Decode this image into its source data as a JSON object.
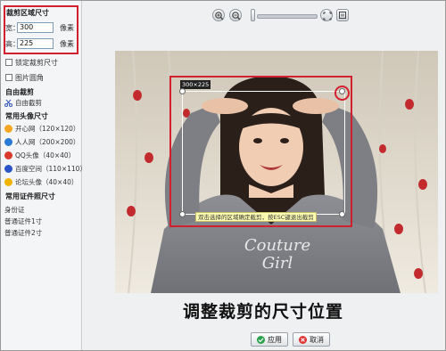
{
  "crop_size": {
    "title": "裁剪区域尺寸",
    "width_label": "宽：",
    "width_value": "300",
    "height_label": "高：",
    "height_value": "225",
    "unit": "像素"
  },
  "options": {
    "lock_size": "锁定裁剪尺寸",
    "round_corner": "图片圆角"
  },
  "free_crop": {
    "title": "自由裁剪",
    "item": "自由截剪"
  },
  "avatar_sizes": {
    "title": "常用头像尺寸",
    "items": [
      {
        "label": "开心网（120×120）",
        "color": "#f5a623"
      },
      {
        "label": "人人网（200×200）",
        "color": "#2a7bd6"
      },
      {
        "label": "QQ头像（40×40）",
        "color": "#d93a2b"
      },
      {
        "label": "百度空间（110×110）",
        "color": "#2a55c8"
      },
      {
        "label": "论坛头像（40×40）",
        "color": "#f0b400"
      }
    ]
  },
  "id_sizes": {
    "title": "常用证件照尺寸",
    "items": [
      "身份证",
      "普通证件1寸",
      "普通证件2寸"
    ]
  },
  "toolbar": {
    "icons": [
      "zoom-in-icon",
      "zoom-out-icon",
      "fit-icon",
      "actual-size-icon"
    ],
    "zoom_level": 0.1
  },
  "crop_overlay": {
    "size_tag": "300×225",
    "hint": "双击选择的区域确定截剪，按ESC键退出截剪"
  },
  "caption": "调整裁剪的尺寸位置",
  "actions": {
    "apply": "应用",
    "cancel": "取消"
  },
  "colors": {
    "highlight": "#d3202f",
    "apply": "#2aa14a",
    "cancel": "#d33"
  }
}
